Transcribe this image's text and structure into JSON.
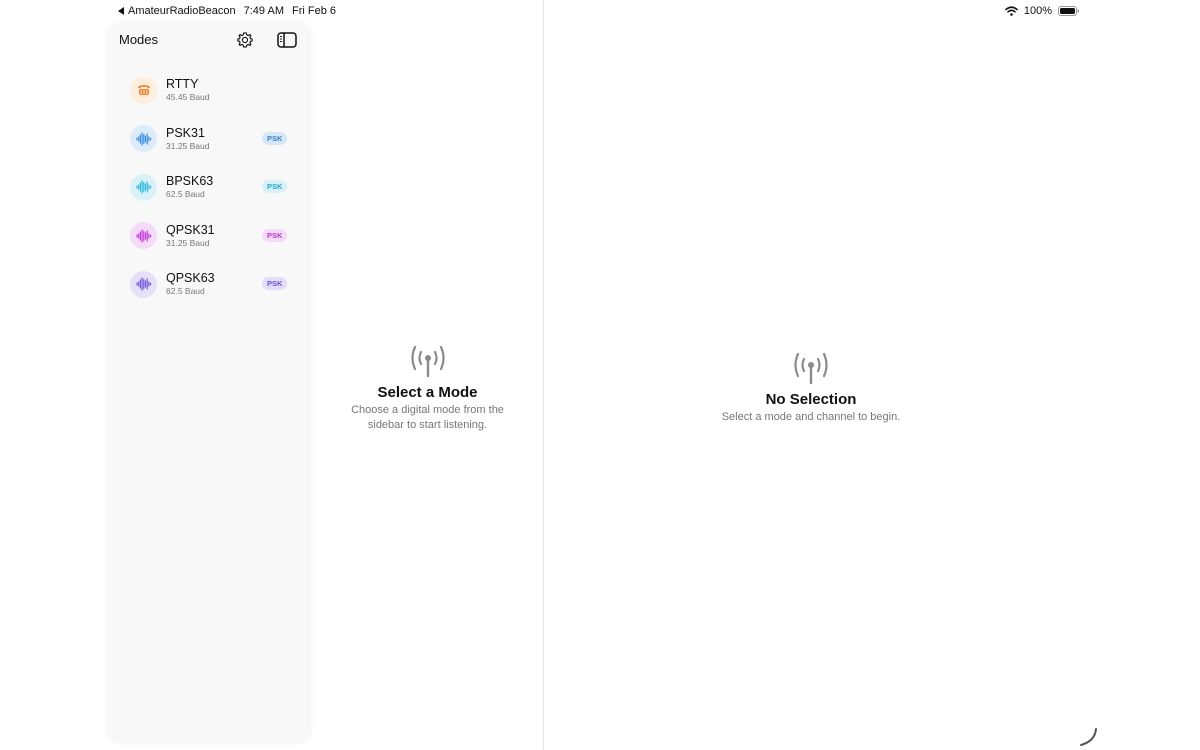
{
  "status_bar": {
    "back_app": "AmateurRadioBeacon",
    "time": "7:49 AM",
    "date": "Fri Feb 6",
    "battery": "100%"
  },
  "sidebar": {
    "title": "Modes",
    "settings_icon": "gear-icon",
    "toggle_icon": "sidebar-toggle-icon",
    "modes": [
      {
        "name": "RTTY",
        "baud": "45.45 Baud",
        "badge": "",
        "icon": "teletype-icon",
        "color": "#f0883c",
        "bg": "#fdeede"
      },
      {
        "name": "PSK31",
        "baud": "31.25 Baud",
        "badge": "PSK",
        "icon": "waveform-icon",
        "color": "#3b8ce0",
        "bg": "#dcebfa",
        "badge_color": "#3b82c4",
        "badge_bg": "#d6e8f8"
      },
      {
        "name": "BPSK63",
        "baud": "62.5 Baud",
        "badge": "PSK",
        "icon": "waveform-icon",
        "color": "#34b9dd",
        "bg": "#d9f2fa",
        "badge_color": "#2aa6c8",
        "badge_bg": "#d6f1f8"
      },
      {
        "name": "QPSK31",
        "baud": "31.25 Baud",
        "badge": "PSK",
        "icon": "waveform-icon",
        "color": "#c13bd6",
        "bg": "#f4dcf8",
        "badge_color": "#b63acb",
        "badge_bg": "#f4dbf7"
      },
      {
        "name": "QPSK63",
        "baud": "62.5 Baud",
        "badge": "PSK",
        "icon": "waveform-icon",
        "color": "#7358d9",
        "bg": "#e5e0f8",
        "badge_color": "#6a52cc",
        "badge_bg": "#e3ddf7"
      }
    ]
  },
  "middle": {
    "icon": "antenna-icon",
    "title": "Select a Mode",
    "description": "Choose a digital mode from the sidebar to start listening."
  },
  "detail": {
    "icon": "antenna-icon",
    "title": "No Selection",
    "description": "Select a mode and channel to begin."
  }
}
